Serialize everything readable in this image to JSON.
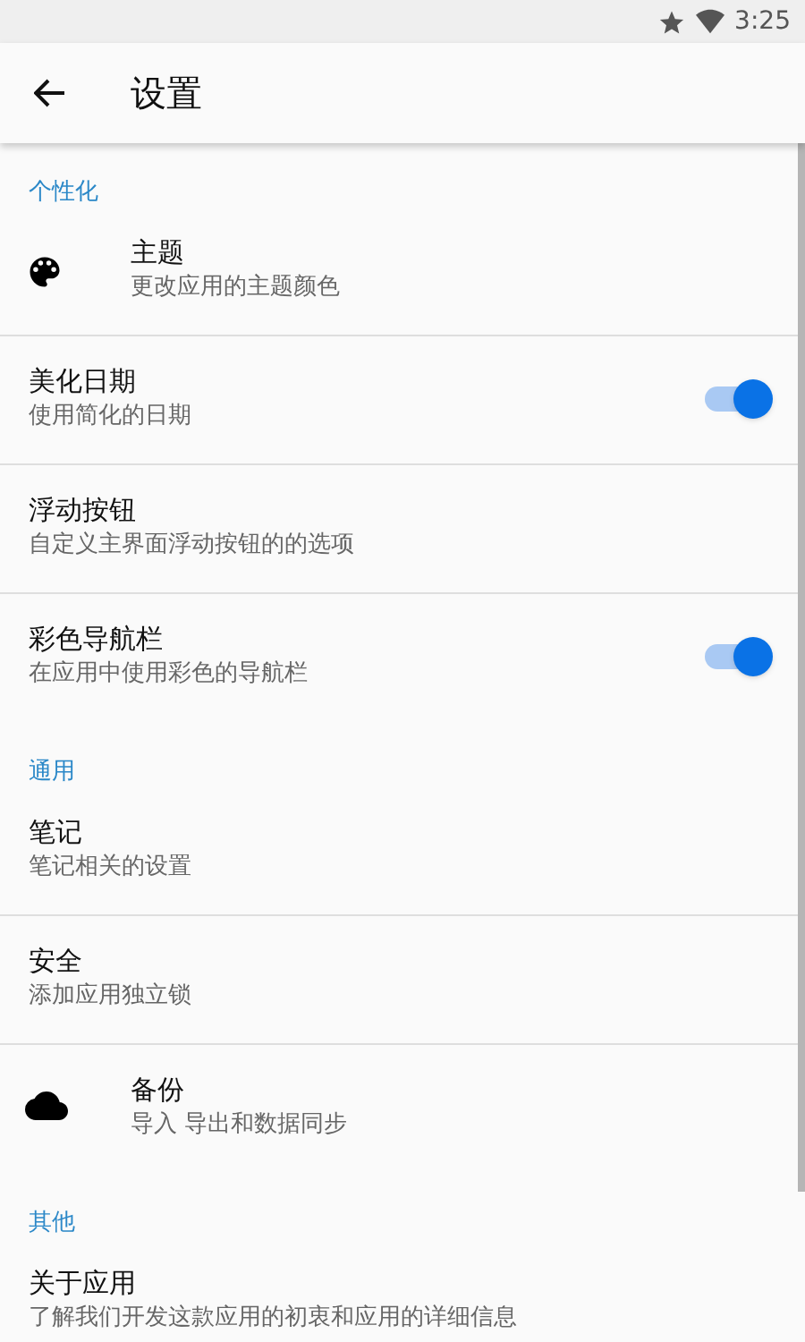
{
  "status_bar": {
    "time": "3:25"
  },
  "app_bar": {
    "title": "设置"
  },
  "sections": [
    {
      "title": "个性化",
      "items": [
        {
          "kind": "icon",
          "title": "主题",
          "subtitle": "更改应用的主题颜色"
        },
        {
          "kind": "toggle",
          "title": "美化日期",
          "subtitle": "使用简化的日期",
          "on": true
        },
        {
          "kind": "plain",
          "title": "浮动按钮",
          "subtitle": "自定义主界面浮动按钮的的选项"
        },
        {
          "kind": "toggle",
          "title": "彩色导航栏",
          "subtitle": "在应用中使用彩色的导航栏",
          "on": true
        }
      ]
    },
    {
      "title": "通用",
      "items": [
        {
          "kind": "plain",
          "title": "笔记",
          "subtitle": "笔记相关的设置"
        },
        {
          "kind": "plain",
          "title": "安全",
          "subtitle": "添加应用独立锁"
        },
        {
          "kind": "icon",
          "title": "备份",
          "subtitle": "导入 导出和数据同步"
        }
      ]
    },
    {
      "title": "其他",
      "items": [
        {
          "kind": "plain",
          "title": "关于应用",
          "subtitle": "了解我们开发这款应用的初衷和应用的详细信息"
        }
      ]
    }
  ]
}
